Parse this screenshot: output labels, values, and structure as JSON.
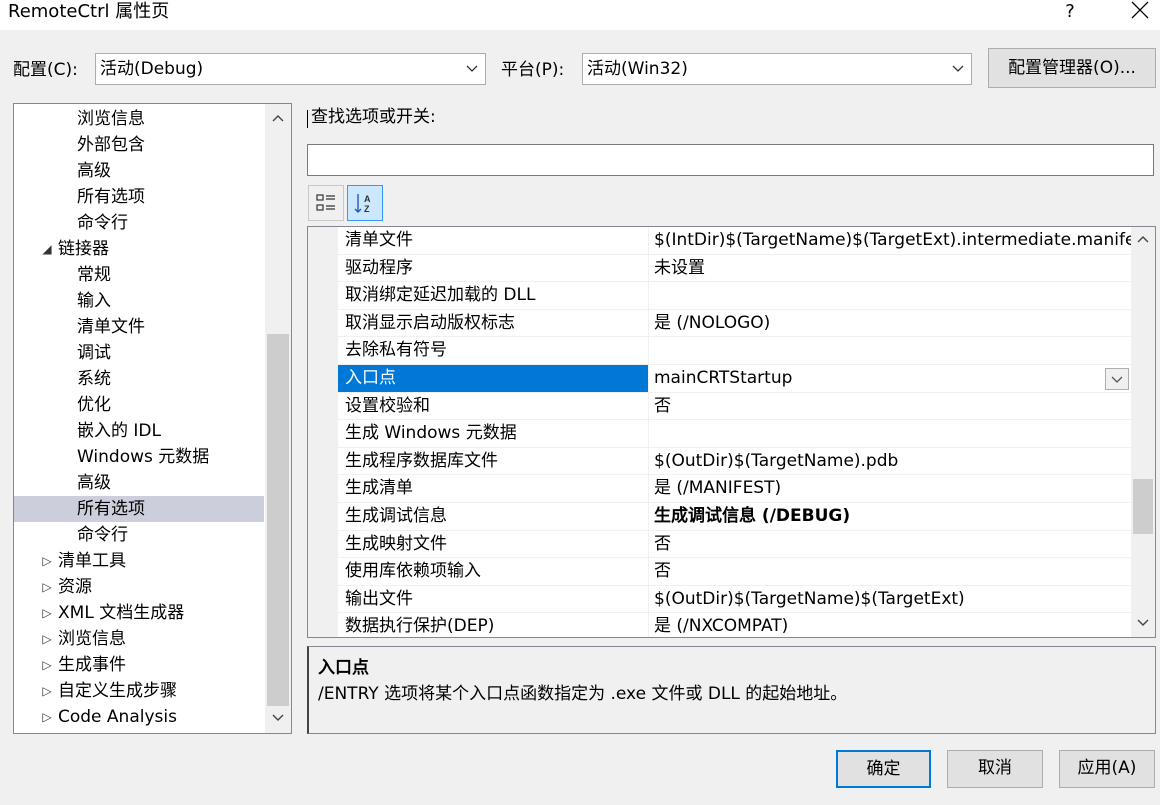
{
  "window": {
    "title": "RemoteCtrl 属性页",
    "help_label": "?",
    "close_icon": "close-icon"
  },
  "config_row": {
    "config_label": "配置(C):",
    "config_value": "活动(Debug)",
    "platform_label": "平台(P):",
    "platform_value": "活动(Win32)",
    "manager_button": "配置管理器(O)..."
  },
  "tree": {
    "items": [
      {
        "label": "浏览信息",
        "level": 2,
        "expander": ""
      },
      {
        "label": "外部包含",
        "level": 2,
        "expander": ""
      },
      {
        "label": "高级",
        "level": 2,
        "expander": ""
      },
      {
        "label": "所有选项",
        "level": 2,
        "expander": ""
      },
      {
        "label": "命令行",
        "level": 2,
        "expander": ""
      },
      {
        "label": "链接器",
        "level": 1,
        "expander": "expanded"
      },
      {
        "label": "常规",
        "level": 2,
        "expander": ""
      },
      {
        "label": "输入",
        "level": 2,
        "expander": ""
      },
      {
        "label": "清单文件",
        "level": 2,
        "expander": ""
      },
      {
        "label": "调试",
        "level": 2,
        "expander": ""
      },
      {
        "label": "系统",
        "level": 2,
        "expander": ""
      },
      {
        "label": "优化",
        "level": 2,
        "expander": ""
      },
      {
        "label": "嵌入的 IDL",
        "level": 2,
        "expander": ""
      },
      {
        "label": "Windows 元数据",
        "level": 2,
        "expander": ""
      },
      {
        "label": "高级",
        "level": 2,
        "expander": ""
      },
      {
        "label": "所有选项",
        "level": 2,
        "expander": "",
        "selected": true
      },
      {
        "label": "命令行",
        "level": 2,
        "expander": ""
      },
      {
        "label": "清单工具",
        "level": 1,
        "expander": "collapsed"
      },
      {
        "label": "资源",
        "level": 1,
        "expander": "collapsed"
      },
      {
        "label": "XML 文档生成器",
        "level": 1,
        "expander": "collapsed"
      },
      {
        "label": "浏览信息",
        "level": 1,
        "expander": "collapsed"
      },
      {
        "label": "生成事件",
        "level": 1,
        "expander": "collapsed"
      },
      {
        "label": "自定义生成步骤",
        "level": 1,
        "expander": "collapsed"
      },
      {
        "label": "Code Analysis",
        "level": 1,
        "expander": "collapsed"
      }
    ]
  },
  "search": {
    "label": "查找选项或开关:",
    "value": ""
  },
  "toolbar": {
    "categorized_icon": "categorized-view-icon",
    "alphabetical_icon": "sort-alphabetical-icon"
  },
  "properties": [
    {
      "name": "清单文件",
      "value": "$(IntDir)$(TargetName)$(TargetExt).intermediate.manifest"
    },
    {
      "name": "驱动程序",
      "value": "未设置"
    },
    {
      "name": "取消绑定延迟加载的 DLL",
      "value": ""
    },
    {
      "name": "取消显示启动版权标志",
      "value": "是 (/NOLOGO)"
    },
    {
      "name": "去除私有符号",
      "value": ""
    },
    {
      "name": "入口点",
      "value": "mainCRTStartup",
      "selected": true
    },
    {
      "name": "设置校验和",
      "value": "否"
    },
    {
      "name": "生成 Windows 元数据",
      "value": ""
    },
    {
      "name": "生成程序数据库文件",
      "value": "$(OutDir)$(TargetName).pdb"
    },
    {
      "name": "生成清单",
      "value": "是 (/MANIFEST)"
    },
    {
      "name": "生成调试信息",
      "value": "生成调试信息 (/DEBUG)",
      "bold": true
    },
    {
      "name": "生成映射文件",
      "value": "否"
    },
    {
      "name": "使用库依赖项输入",
      "value": "否"
    },
    {
      "name": "输出文件",
      "value": "$(OutDir)$(TargetName)$(TargetExt)"
    },
    {
      "name": "数据执行保护(DEP)",
      "value": "是 (/NXCOMPAT)"
    }
  ],
  "description": {
    "title": "入口点",
    "text": "/ENTRY 选项将某个入口点函数指定为 .exe 文件或 DLL 的起始地址。"
  },
  "buttons": {
    "ok": "确定",
    "cancel": "取消",
    "apply": "应用(A)"
  }
}
